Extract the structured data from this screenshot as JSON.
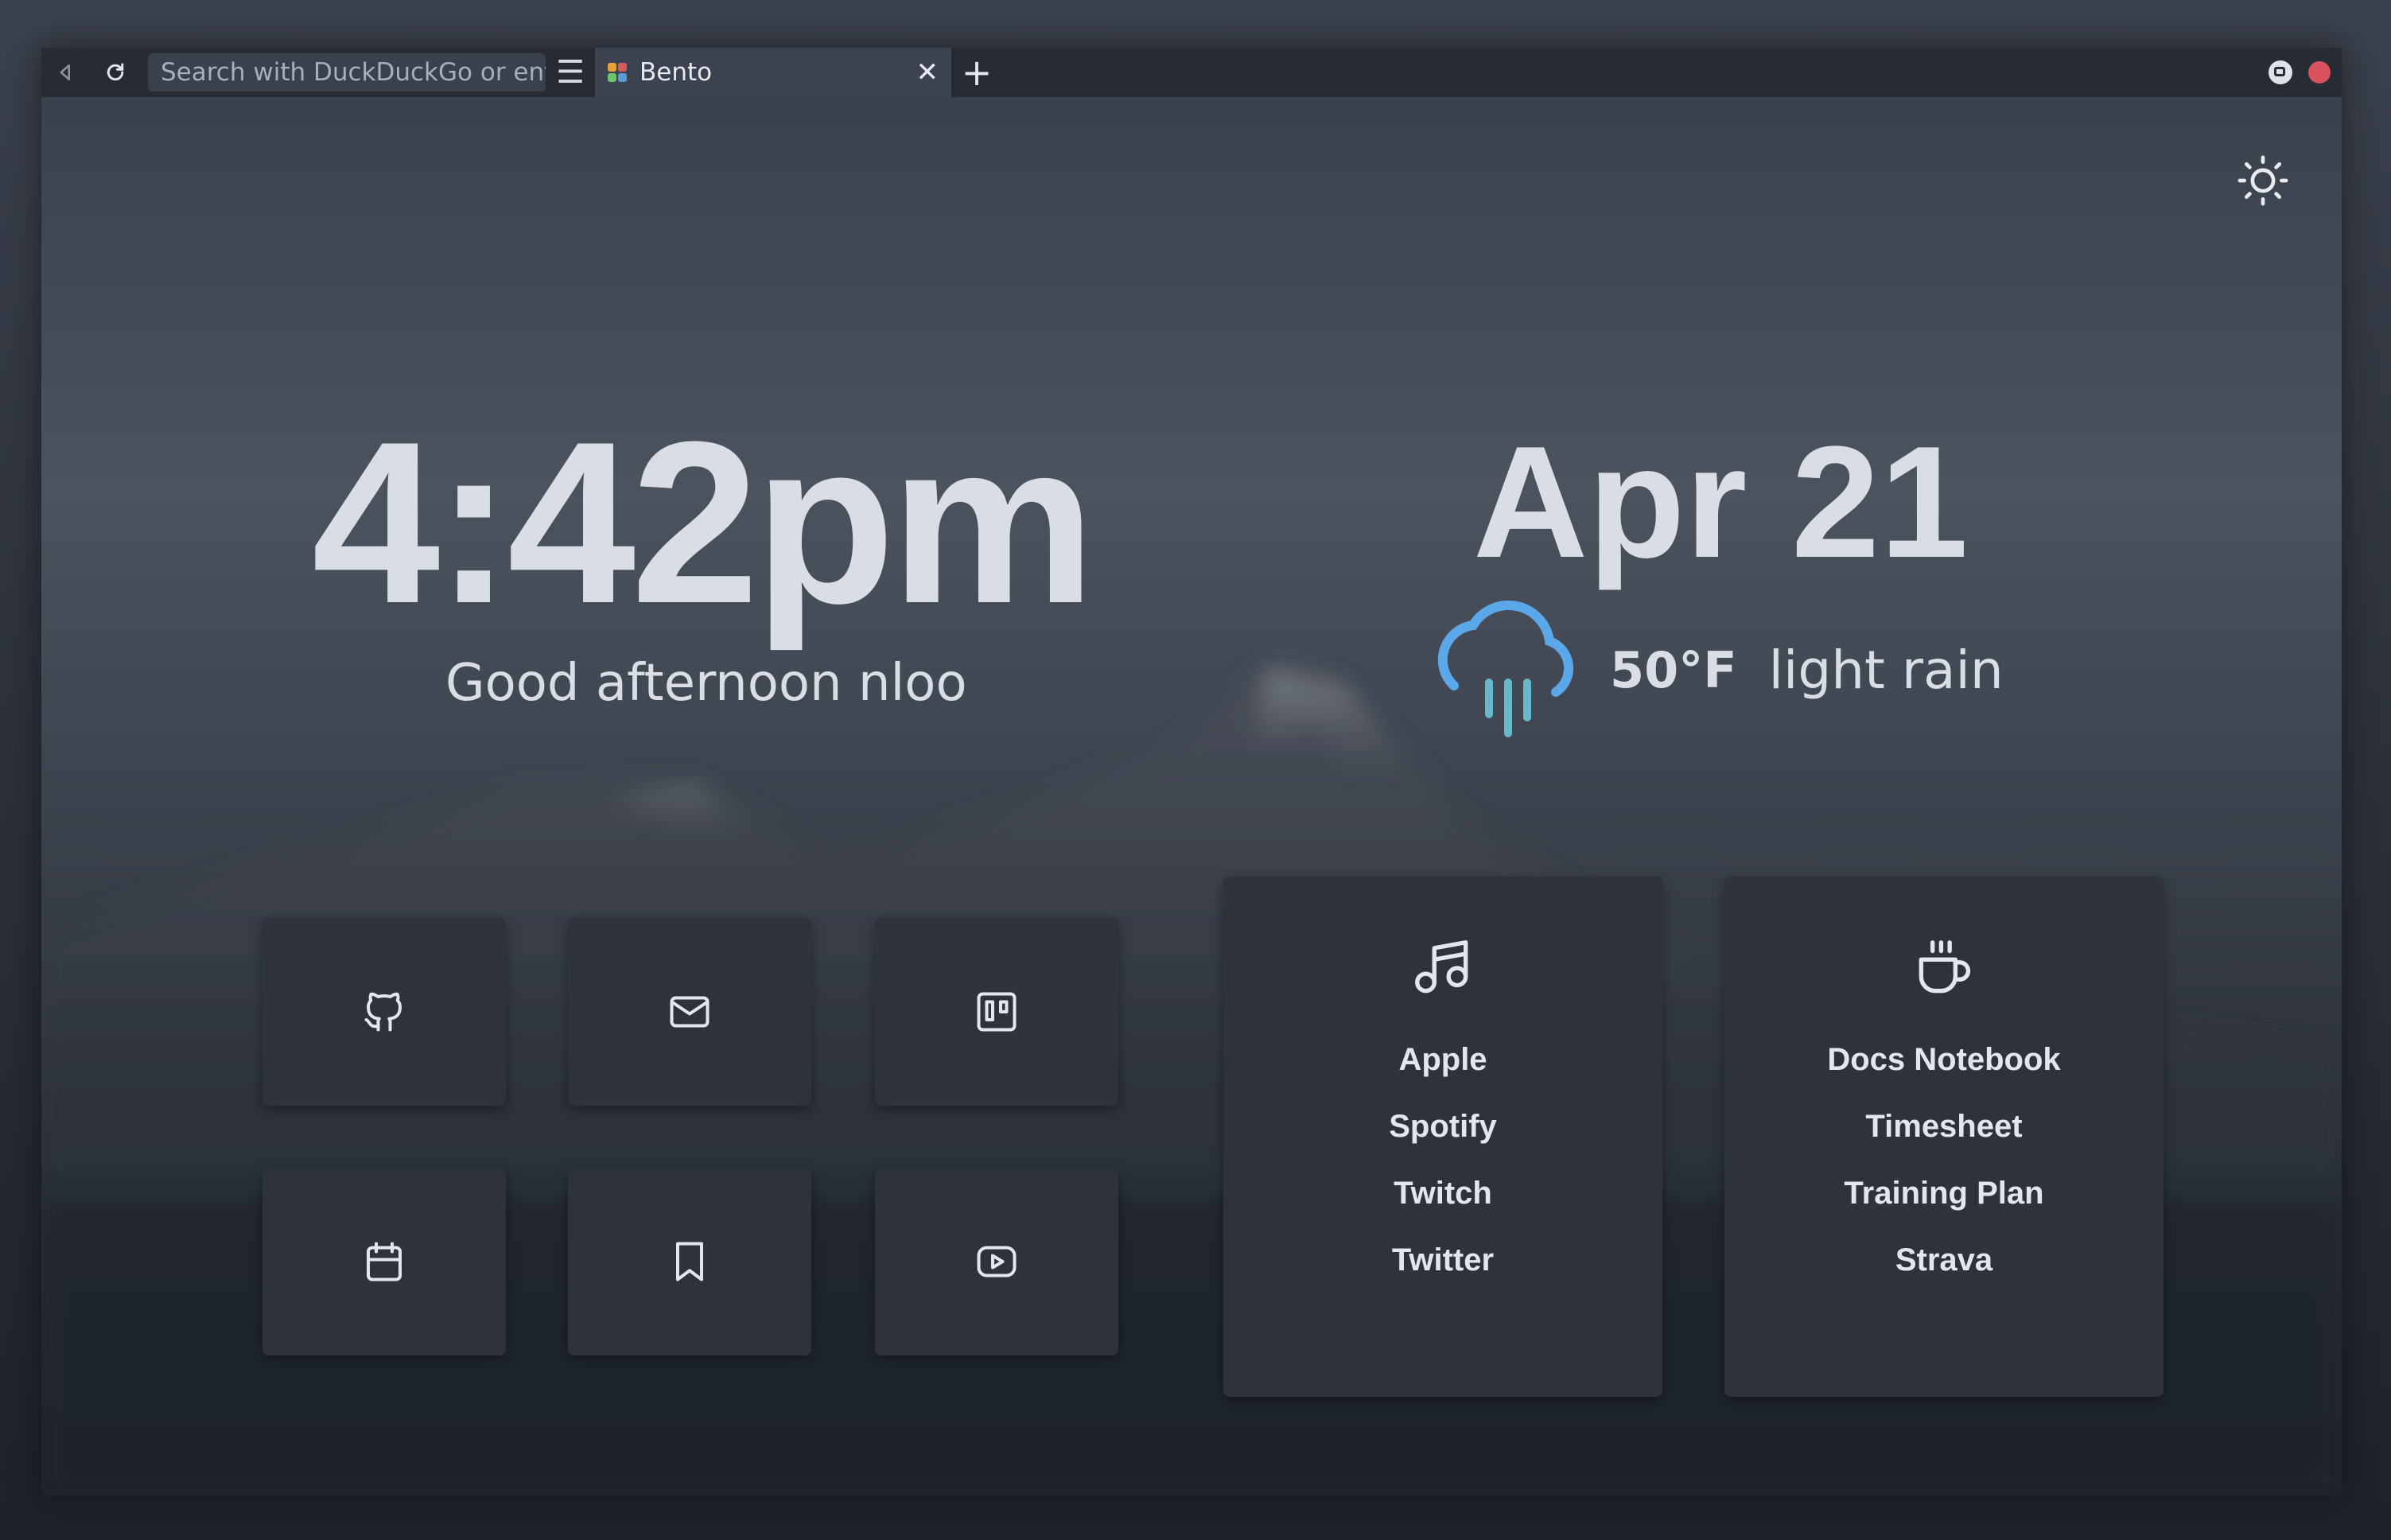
{
  "browser": {
    "url_placeholder": "Search with DuckDuckGo or enter address",
    "tab_title": "Bento",
    "tab_close": "✕",
    "new_tab": "+",
    "menu": "☰",
    "status_dot_color": "#d9525e"
  },
  "page": {
    "time": "4:42pm",
    "greeting": "Good afternoon nloo",
    "date": "Apr 21",
    "weather": {
      "icon": "rain-cloud-icon",
      "temperature": "50°F",
      "condition": "light rain"
    },
    "theme_toggle_icon": "sun-icon"
  },
  "tiles": [
    {
      "icon": "github-icon"
    },
    {
      "icon": "mail-icon"
    },
    {
      "icon": "trello-icon"
    },
    {
      "icon": "calendar-icon"
    },
    {
      "icon": "bookmark-icon"
    },
    {
      "icon": "youtube-icon"
    }
  ],
  "cards": [
    {
      "icon": "music-icon",
      "links": [
        "Apple",
        "Spotify",
        "Twitch",
        "Twitter"
      ]
    },
    {
      "icon": "coffee-icon",
      "links": [
        "Docs Notebook",
        "Timesheet",
        "Training Plan",
        "Strava"
      ]
    }
  ],
  "colors": {
    "accent_weather_cloud": "#5aa7ea",
    "accent_weather_rain": "#68b8c9",
    "text": "#d9dde5",
    "tile_bg": "#2d323d"
  }
}
